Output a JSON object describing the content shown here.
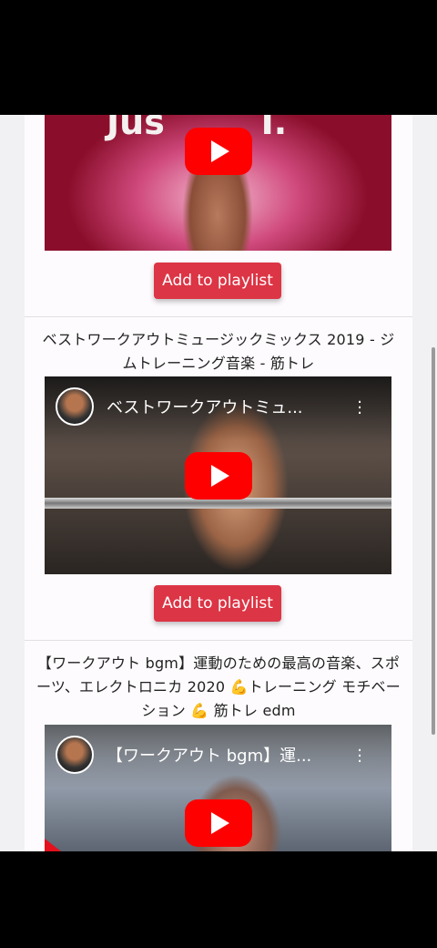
{
  "videos": [
    {
      "title": "",
      "overlay_title": "",
      "thumb_text": "Jus        I.",
      "button_label": "Add to playlist"
    },
    {
      "title": "ベストワークアウトミュージックミックス 2019 - ジムトレーニング音楽 - 筋トレ",
      "overlay_title": "ベストワークアウトミュ...",
      "button_label": "Add to playlist"
    },
    {
      "title": "【ワークアウト bgm】運動のための最高の音楽、スポーツ、エレクトロニカ 2020 💪トレーニング モチベーション 💪 筋トレ edm",
      "overlay_title": "【ワークアウト bgm】運...",
      "button_label": ""
    }
  ],
  "icons": {
    "play": "youtube-play-icon",
    "menu": "more-vert-icon"
  },
  "colors": {
    "button": "#dc3545",
    "play": "#ff0000",
    "card_bg": "#fdfbfd"
  }
}
